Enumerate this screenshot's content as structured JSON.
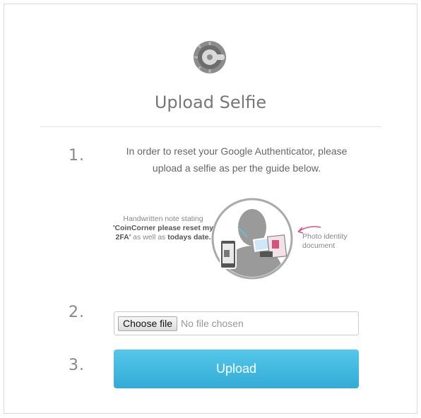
{
  "page": {
    "title": "Upload Selfie",
    "logo_icon": "google-authenticator-icon"
  },
  "steps": [
    {
      "number": "1.",
      "text": "In order to reset your Google Authenticator, please upload a selfie as per the guide below."
    },
    {
      "number": "2."
    },
    {
      "number": "3."
    }
  ],
  "illustration": {
    "note_line1": "Handwritten note stating",
    "note_bold": "'CoinCorner please reset my 2FA'",
    "note_mid": " as well as ",
    "note_bold2": "todays date.",
    "id_label": "Photo identity document"
  },
  "file_input": {
    "button_label": "Choose file",
    "status": "No file chosen"
  },
  "upload_button": {
    "label": "Upload"
  },
  "colors": {
    "accent": "#3bb6df",
    "note_arrow": "#5ec8e8",
    "id_arrow": "#d6527f",
    "silhouette": "#9a9a9a"
  }
}
